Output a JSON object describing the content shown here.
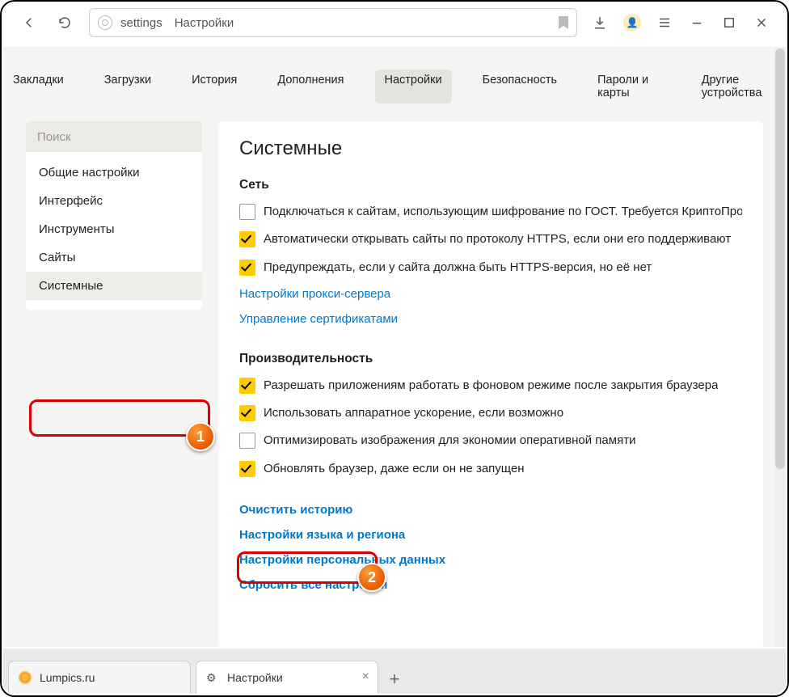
{
  "address": {
    "text": "settings Настройки"
  },
  "nav": {
    "items": [
      "Закладки",
      "Загрузки",
      "История",
      "Дополнения",
      "Настройки",
      "Безопасность",
      "Пароли и карты",
      "Другие устройства"
    ],
    "activeIndex": 4
  },
  "sidebar": {
    "search_placeholder": "Поиск",
    "items": [
      "Общие настройки",
      "Интерфейс",
      "Инструменты",
      "Сайты",
      "Системные"
    ],
    "activeIndex": 4
  },
  "page": {
    "title": "Системные"
  },
  "sections": {
    "network": {
      "title": "Сеть",
      "checks": [
        {
          "checked": false,
          "label": "Подключаться к сайтам, использующим шифрование по ГОСТ. Требуется КриптоПро C"
        },
        {
          "checked": true,
          "label": "Автоматически открывать сайты по протоколу HTTPS, если они его поддерживают"
        },
        {
          "checked": true,
          "label": "Предупреждать, если у сайта должна быть HTTPS-версия, но её нет"
        }
      ],
      "links": [
        "Настройки прокси-сервера",
        "Управление сертификатами"
      ]
    },
    "performance": {
      "title": "Производительность",
      "checks": [
        {
          "checked": true,
          "label": "Разрешать приложениям работать в фоновом режиме после закрытия браузера"
        },
        {
          "checked": true,
          "label": "Использовать аппаратное ускорение, если возможно"
        },
        {
          "checked": false,
          "label": "Оптимизировать изображения для экономии оперативной памяти"
        },
        {
          "checked": true,
          "label": "Обновлять браузер, даже если он не запущен"
        }
      ]
    },
    "actions": {
      "links": [
        "Очистить историю",
        "Настройки языка и региона",
        "Настройки персональных данных",
        "Сбросить все настройки"
      ]
    }
  },
  "callouts": {
    "b1": "1",
    "b2": "2"
  },
  "tabs": {
    "t0": "Lumpics.ru",
    "t1": "Настройки"
  }
}
